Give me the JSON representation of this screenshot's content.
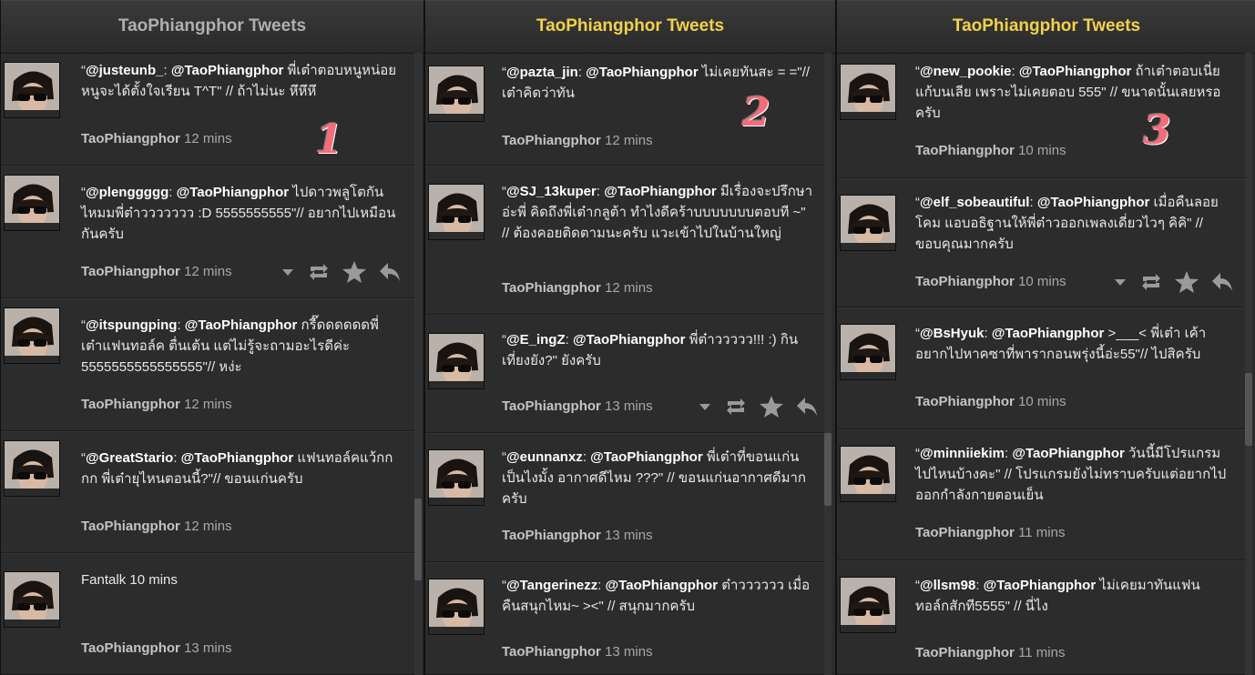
{
  "columns": [
    {
      "title": "TaoPhiangphor Tweets",
      "title_color": "#b0b0b0",
      "annotation": "1",
      "tweets": [
        {
          "user": "@justeunb_",
          "colon": ":",
          "mention": "@TaoPhiangphor",
          "body": " พี่เต๋าตอบหนูหน่อย หนูจะได้ตั้งใจเรียน T^T\" // ถ้าไม่นะ หึหึหึ",
          "author": "TaoPhiangphor",
          "time": "12 mins"
        },
        {
          "user": "@plenggggg",
          "colon": ":",
          "mention": "@TaoPhiangphor",
          "body": " ไปดาวพลูโตกันไหมมพี่ต๋าววววววว :D 5555555555\"// อยากไปเหมือนกันครับ",
          "author": "TaoPhiangphor",
          "time": "12 mins"
        },
        {
          "user": "@itspungping",
          "colon": ":",
          "mention": "@TaoPhiangphor",
          "body": " กรี๊ดดดดดดพี่เต๋าแฟนทอล์ค ตื่นเต้น แต่ไม่รู้จะถามอะไรดีค่ะ 5555555555555555\"// หง่ะ",
          "author": "TaoPhiangphor",
          "time": "12 mins"
        },
        {
          "user": "@GreatStario",
          "colon": ":",
          "mention": "@TaoPhiangphor",
          "body": " แฟนทอล์คแว้กกกก พี่เต๋ายุไหนตอนนี้?\"// ขอนแก่นครับ",
          "author": "TaoPhiangphor",
          "time": "12 mins"
        },
        {
          "plain": "Fantalk 10 mins",
          "author": "TaoPhiangphor",
          "time": "13 mins"
        }
      ]
    },
    {
      "title": "TaoPhiangphor Tweets",
      "title_color": "#f2d24a",
      "annotation": "2",
      "tweets": [
        {
          "user": "@pazta_jin",
          "colon": ":",
          "mention": "@TaoPhiangphor",
          "body": " ไม่เคยทันสะ = =\"// เต๋าคิดว่าทัน",
          "author": "TaoPhiangphor",
          "time": "12 mins"
        },
        {
          "user": "@SJ_13kuper",
          "colon": ":",
          "mention": "@TaoPhiangphor",
          "body": " มีเรื่องจะปรึกษาอ่ะพี่ คิดถึงพี่เต๋ากลูต้า ทำไงดีคร้าบบบบบบบตอบที ~\" // ต้องคอยติดตามนะครับ แวะเข้าไปในบ้านใหญ่",
          "author": "TaoPhiangphor",
          "time": "12 mins"
        },
        {
          "user": "@E_ingZ",
          "colon": ":",
          "mention": "@TaoPhiangphor",
          "body": " พี่ต๋าววววว!!! :) กินเที่ยงยัง?\" ยังครับ",
          "author": "TaoPhiangphor",
          "time": "13 mins"
        },
        {
          "user": "@eunnanxz",
          "colon": ":",
          "mention": "@TaoPhiangphor",
          "body": " พี่เต๋าที่ขอนแก่นเป็นไงมั้ง อากาศดีไหม ???\" // ขอนแก่นอากาศดีมากครับ",
          "author": "TaoPhiangphor",
          "time": "13 mins"
        },
        {
          "user": "@Tangerinezz",
          "colon": ":",
          "mention": "@TaoPhiangphor",
          "body": " ต๋าวววววว เมื่อคืนสนุกไหม~ ><\" // สนุกมากครับ",
          "author": "TaoPhiangphor",
          "time": "13 mins"
        }
      ]
    },
    {
      "title": "TaoPhiangphor Tweets",
      "title_color": "#f2d24a",
      "annotation": "3",
      "tweets": [
        {
          "user": "@new_pookie",
          "colon": ":",
          "mention": "@TaoPhiangphor",
          "body": " ถ้าเต๋าตอบเนี่ย แก้บนเลีย เพราะไม่เคยตอบ 555\" // ขนาดนั้นเลยหรอครับ",
          "author": "TaoPhiangphor",
          "time": "10 mins"
        },
        {
          "user": "@elf_sobeautiful",
          "colon": ":",
          "mention": "@TaoPhiangphor",
          "body": " เมื่อคืนลอยโคม แอบอธิฐานให้พี่ต๋าวออกเพลงเดี่ยวไวๆ คิคิ\" // ขอบคุณมากครับ",
          "author": "TaoPhiangphor",
          "time": "10 mins"
        },
        {
          "user": "@BsHyuk",
          "colon": ":",
          "mention": "@TaoPhiangphor",
          "body": " >___< พี่เต๋า เค้าอยากไปหาคซาที่พารากอนพรุ่งนี้อ่ะ55\"// ไปสิครับ",
          "author": "TaoPhiangphor",
          "time": "10 mins"
        },
        {
          "user": "@minniiekim",
          "colon": ":",
          "mention": "@TaoPhiangphor",
          "body": " วันนี้มีโปรแกรมไปไหนบ้างคะ\" // โปรแกรมยังไม่ทราบครับแต่อยากไปออกกำลังกายตอนเย็น",
          "author": "TaoPhiangphor",
          "time": "11 mins"
        },
        {
          "user": "@llsm98",
          "colon": ":",
          "mention": "@TaoPhiangphor",
          "body": " ไม่เคยมาทันแฟนทอล์กสักที5555\" // นี่ไง",
          "author": "TaoPhiangphor",
          "time": "11 mins"
        }
      ]
    }
  ],
  "icons": [
    "dropdown-icon",
    "retweet-icon",
    "favorite-icon",
    "reply-icon"
  ]
}
